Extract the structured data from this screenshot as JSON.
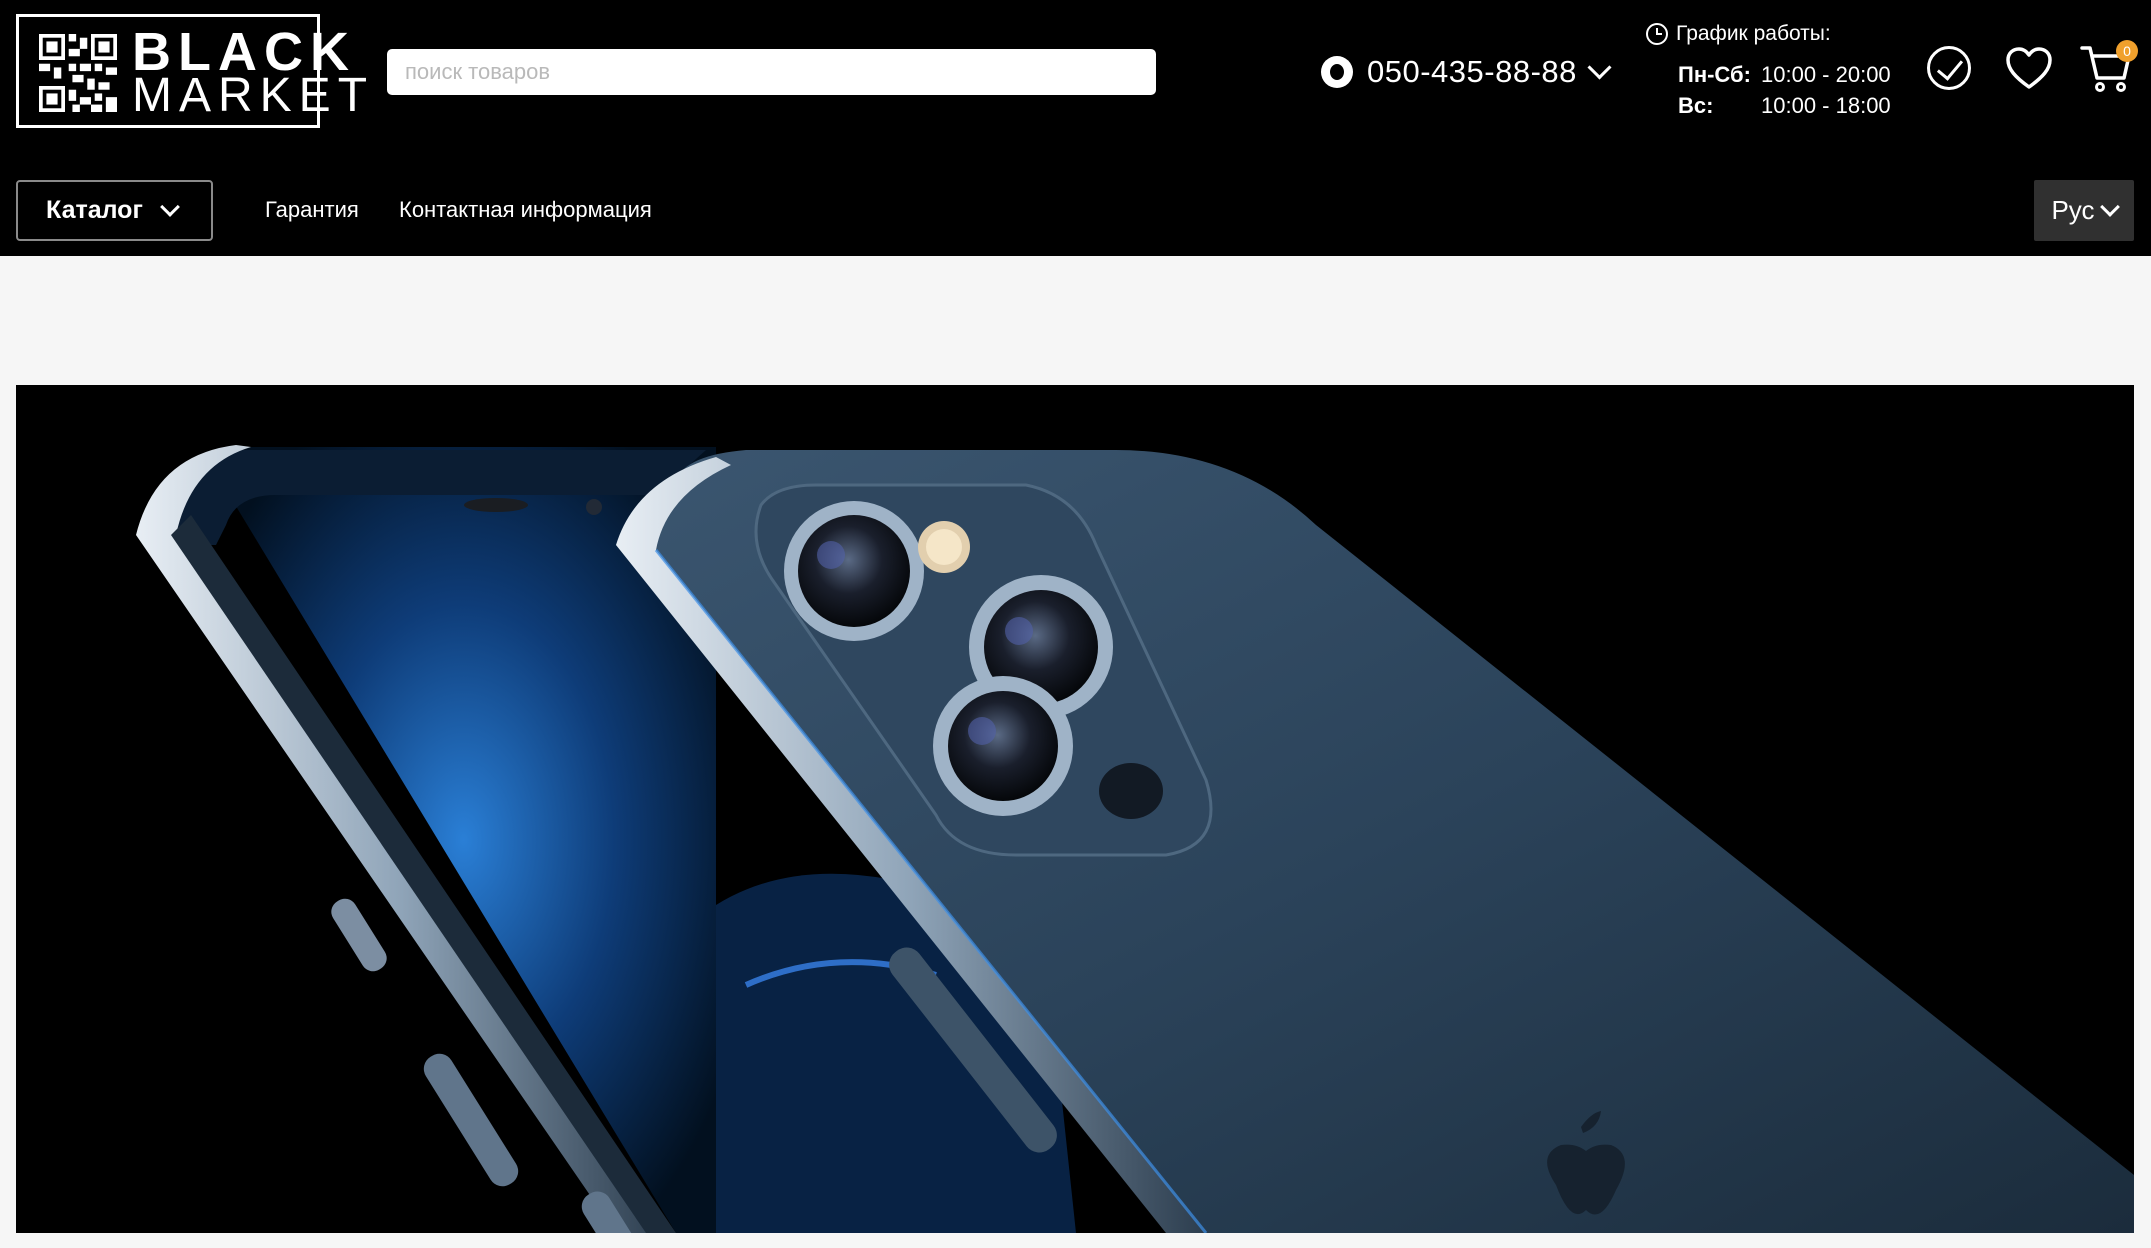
{
  "brand": {
    "line1": "BLACK",
    "line2": "MARKET"
  },
  "search": {
    "placeholder": "поиск товаров",
    "value": ""
  },
  "phone": {
    "number": "050-435-88-88",
    "icon": "vodafone-icon"
  },
  "schedule": {
    "title": "График работы:",
    "rows": [
      {
        "days": "Пн-Сб:",
        "hours": "10:00 - 20:00"
      },
      {
        "days": "Вс:",
        "hours": "10:00 - 18:00"
      }
    ]
  },
  "icons": {
    "compare": "check-circle-icon",
    "favorites": "heart-icon",
    "cart": "cart-icon"
  },
  "cart": {
    "count": "0"
  },
  "nav": {
    "catalog_label": "Каталог",
    "links": [
      "Гарантия",
      "Контактная информация"
    ]
  },
  "language": {
    "selected": "Рус"
  },
  "banner": {
    "image": "phone-product-photo"
  },
  "colors": {
    "header_bg": "#000000",
    "page_bg": "#f6f6f6",
    "badge": "#f0a02c",
    "lang_bg": "#303030"
  }
}
